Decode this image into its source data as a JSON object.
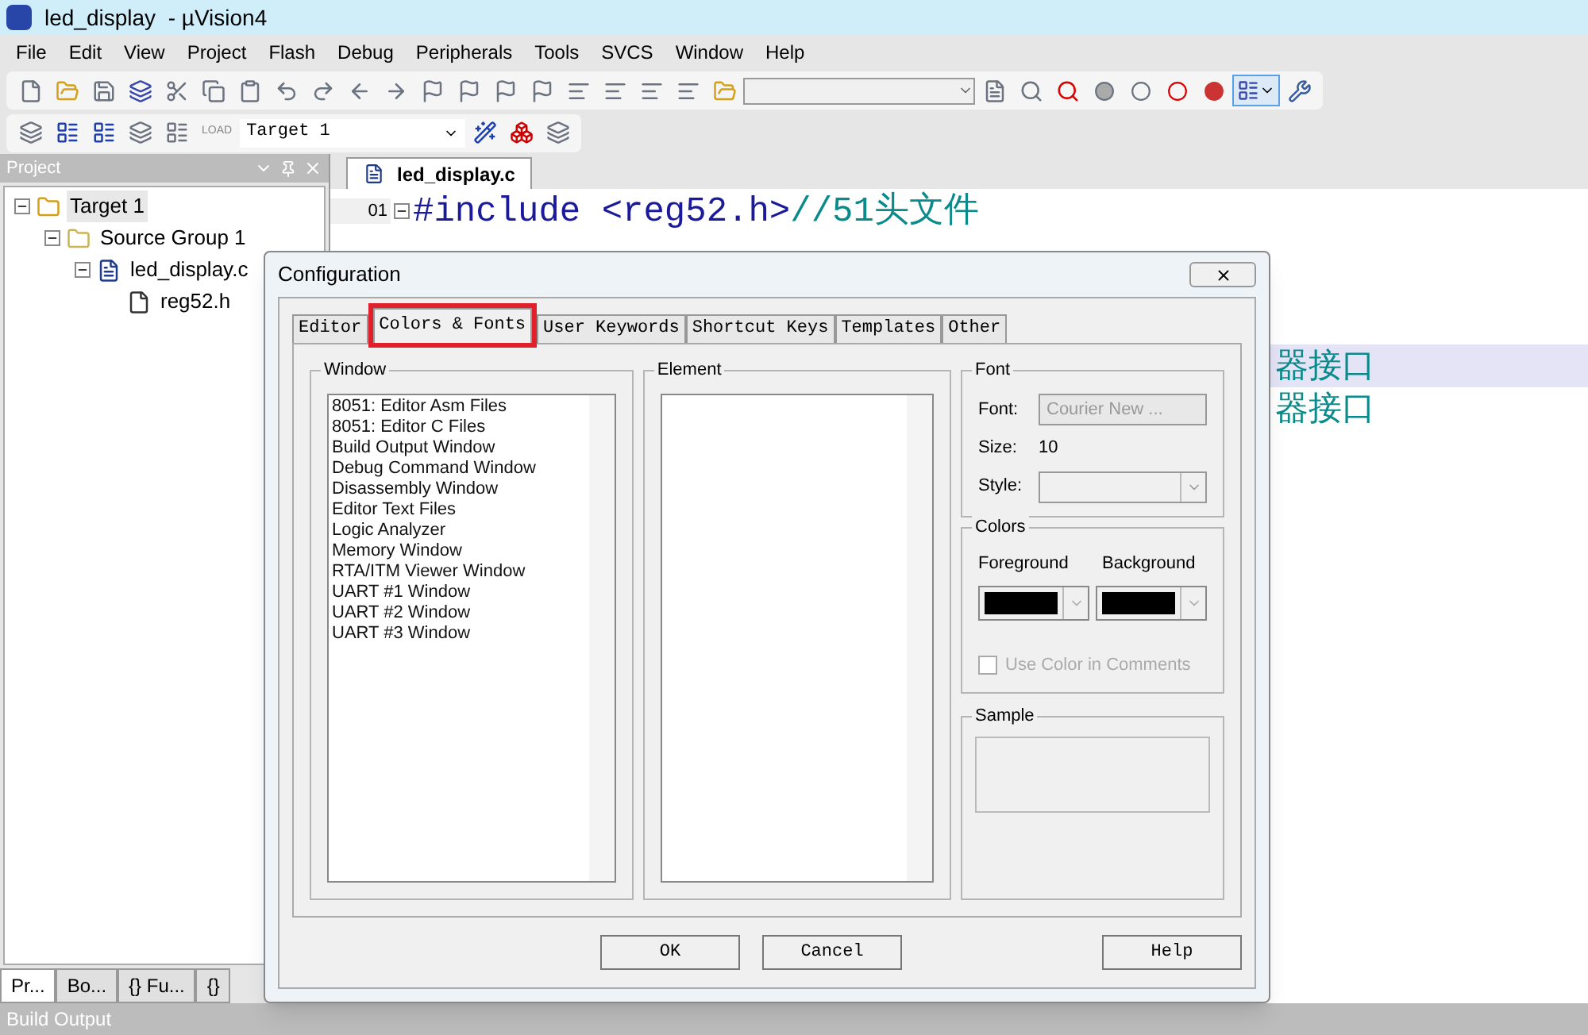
{
  "window": {
    "title": "led_display  - µVision4"
  },
  "menu": [
    "File",
    "Edit",
    "View",
    "Project",
    "Flash",
    "Debug",
    "Peripherals",
    "Tools",
    "SVCS",
    "Window",
    "Help"
  ],
  "toolbar2": {
    "target": "Target 1",
    "load_label": "LOAD"
  },
  "project_panel": {
    "title": "Project",
    "tree": [
      {
        "label": "Target 1",
        "kind": "target",
        "selected": true,
        "children": [
          {
            "label": "Source Group 1",
            "kind": "group",
            "selected": false,
            "children": [
              {
                "label": "led_display.c",
                "kind": "cfile",
                "selected": false,
                "children": [
                  {
                    "label": "reg52.h",
                    "kind": "hfile",
                    "selected": false
                  }
                ]
              }
            ]
          }
        ]
      }
    ],
    "tabs": [
      {
        "label": "Pr...",
        "selected": true
      },
      {
        "label": "Bo...",
        "selected": false
      },
      {
        "label": "{} Fu...",
        "selected": false
      },
      {
        "label": "{}",
        "selected": false
      }
    ]
  },
  "editor": {
    "tab": "led_display.c",
    "lines": [
      {
        "number": "01",
        "code": "#include <reg52.h>",
        "comment": "//51头文件"
      }
    ],
    "visible_fragments": [
      {
        "text": "器接口",
        "highlighted": true
      },
      {
        "text": "器接口",
        "highlighted": false
      }
    ]
  },
  "dialog": {
    "title": "Configuration",
    "tabs": [
      {
        "label": "Editor",
        "selected": false
      },
      {
        "label": "Colors & Fonts",
        "selected": true
      },
      {
        "label": "User Keywords",
        "selected": false
      },
      {
        "label": "Shortcut Keys",
        "selected": false
      },
      {
        "label": "Templates",
        "selected": false
      },
      {
        "label": "Other",
        "selected": false
      }
    ],
    "window_group": {
      "title": "Window",
      "items": [
        "8051: Editor Asm Files",
        "8051: Editor C Files",
        "Build Output Window",
        "Debug Command Window",
        "Disassembly Window",
        "Editor Text Files",
        "Logic Analyzer",
        "Memory Window",
        "RTA/ITM Viewer Window",
        "UART #1 Window",
        "UART #2 Window",
        "UART #3 Window"
      ]
    },
    "element_group": {
      "title": "Element"
    },
    "font_group": {
      "title": "Font",
      "font_label": "Font:",
      "font_button": "Courier New ...",
      "size_label": "Size:",
      "size_value": "10",
      "style_label": "Style:"
    },
    "colors_group": {
      "title": "Colors",
      "foreground_label": "Foreground",
      "background_label": "Background",
      "use_color_in_comments": {
        "label": "Use Color in Comments",
        "checked": false,
        "disabled": true
      }
    },
    "sample_group": {
      "title": "Sample"
    },
    "buttons": [
      "OK",
      "Cancel",
      "Help"
    ]
  },
  "status_bar": {
    "title": "Build Output"
  }
}
